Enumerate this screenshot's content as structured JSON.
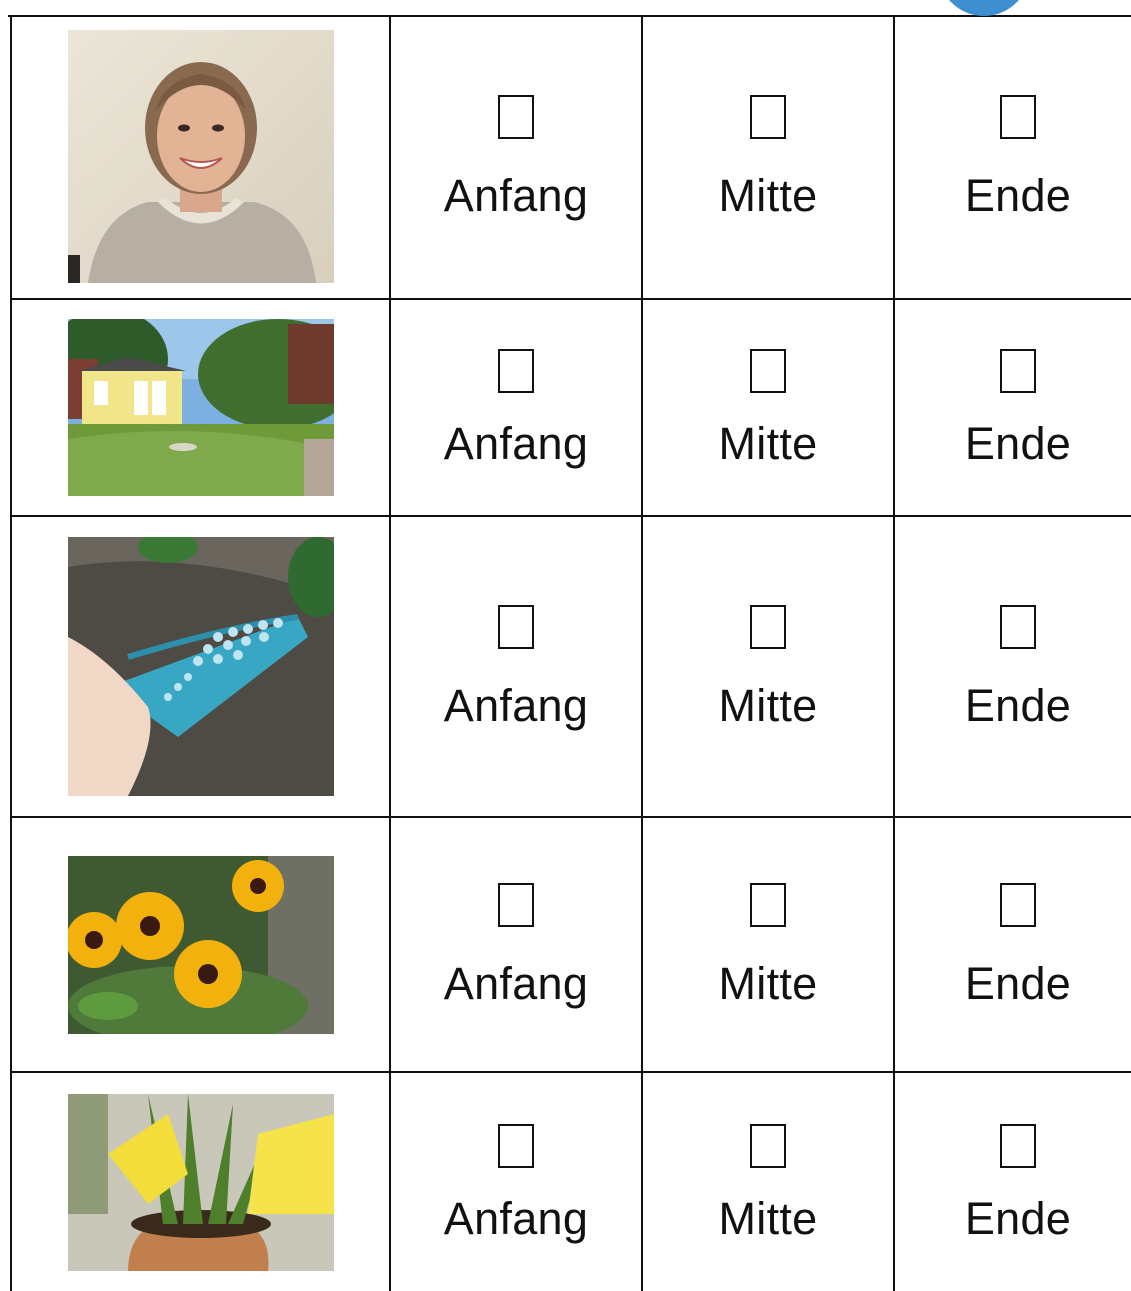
{
  "worksheet": {
    "options": [
      "Anfang",
      "Mitte",
      "Ende"
    ],
    "rows": [
      {
        "image": "woman-portrait-photo",
        "options": [
          "Anfang",
          "Mitte",
          "Ende"
        ]
      },
      {
        "image": "garden-house-lawn-photo",
        "options": [
          "Anfang",
          "Mitte",
          "Ende"
        ]
      },
      {
        "image": "fertilizer-scoop-photo",
        "options": [
          "Anfang",
          "Mitte",
          "Ende"
        ]
      },
      {
        "image": "yellow-flowers-photo",
        "options": [
          "Anfang",
          "Mitte",
          "Ende"
        ]
      },
      {
        "image": "potted-plant-gloves-photo",
        "options": [
          "Anfang",
          "Mitte",
          "Ende"
        ]
      }
    ]
  },
  "colors": {
    "border": "#111111",
    "badge": "#3d8fd0"
  }
}
